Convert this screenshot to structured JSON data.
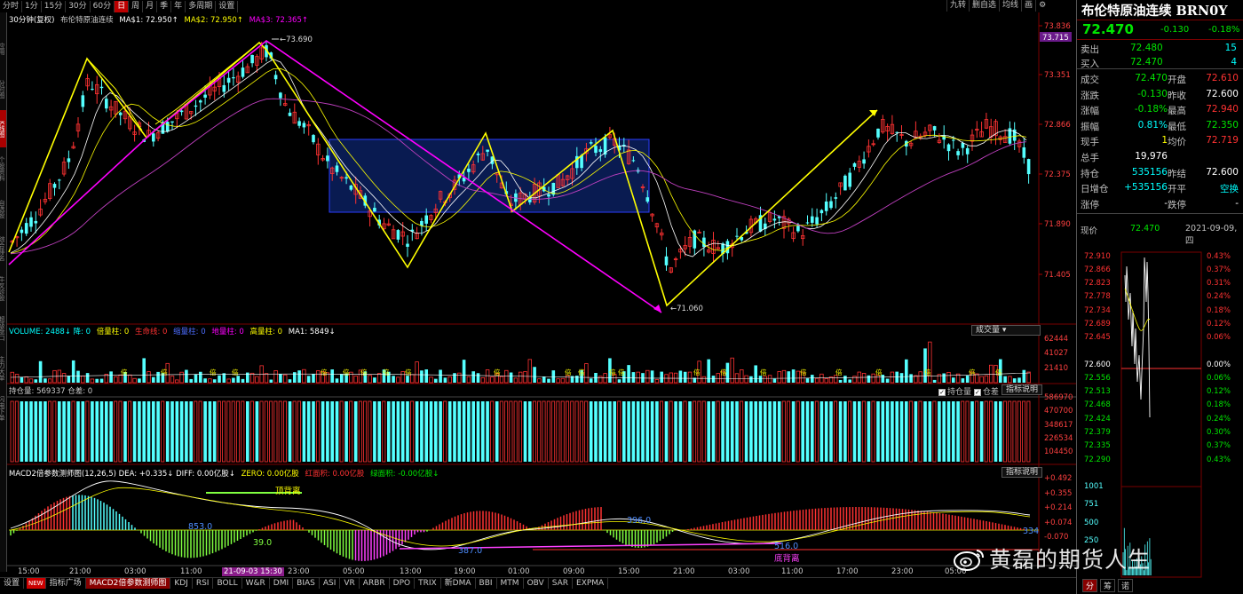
{
  "toolbar": {
    "left": [
      "分时",
      "1分",
      "15分",
      "30分",
      "60分",
      "日",
      "周",
      "月",
      "季",
      "年",
      "多周期",
      "设置"
    ],
    "active": "日",
    "right": [
      "九转",
      "删自选",
      "均线",
      "画",
      "⚙"
    ]
  },
  "left_tabs": [
    "应用",
    "分时图",
    "K线图",
    "个股资料",
    "自选股",
    "综合排名",
    "牛叉诊股",
    "超级盘口",
    "主力大单",
    "闪电下单"
  ],
  "price_title": {
    "period": "30分钟(复权)",
    "name": "布伦特原油连续",
    "ma1": "MA$1: 72.950↑",
    "ma2": "MA$2: 72.950↑",
    "ma3": "MA$3: 72.365↑"
  },
  "price_axis": [
    "73.836",
    "73.351",
    "72.866",
    "72.375",
    "71.890",
    "71.405"
  ],
  "price_axis_hl": "73.715",
  "annotations": {
    "high": "73.690",
    "low": "71.060"
  },
  "volume": {
    "title_parts": [
      {
        "t": "VOLUME: 2488↓ 降: 0 ",
        "c": "c-c"
      },
      {
        "t": "倍量柱: 0 ",
        "c": "c-y"
      },
      {
        "t": "生命线: 0 ",
        "c": "c-r"
      },
      {
        "t": "缩量柱: 0 ",
        "c": "c-b"
      },
      {
        "t": "地量柱: 0 ",
        "c": "c-m"
      },
      {
        "t": "高量柱: 0 ",
        "c": "c-y"
      },
      {
        "t": "MA1: 5849↓",
        "c": "c-w"
      }
    ],
    "selector": "成交量",
    "axis": [
      "62444",
      "41027",
      "21410"
    ],
    "bar_label": "倍"
  },
  "oi": {
    "title": "持仓量: 569337 仓差: 0",
    "chk1": "持仓量",
    "chk2": "仓差",
    "btn": "指标说明",
    "axis": [
      "586970",
      "470700",
      "348617",
      "226534",
      "104450"
    ]
  },
  "macd": {
    "title_parts": [
      {
        "t": "MACD2倍参数测师图(12,26,5) DEA: +0.335↓ DIFF: 0.00亿股↓ ",
        "c": "c-w"
      },
      {
        "t": "ZERO: 0.00亿股 ",
        "c": "c-y"
      },
      {
        "t": "红面积: 0.00亿股 ",
        "c": "c-r"
      },
      {
        "t": "绿面积: -0.00亿股↓",
        "c": "c-g"
      }
    ],
    "btn": "指标说明",
    "axis": [
      "+0.492",
      "+0.355",
      "+0.214",
      "+0.074",
      "-0.070"
    ],
    "labels": {
      "top_div": "顶背离",
      "bottom_div": "底背离",
      "a": "853.0",
      "b": "39.0",
      "c": "387.0",
      "d": "396.0",
      "e": "516.0",
      "f": "334"
    }
  },
  "time_axis": [
    "15:00",
    "21:00",
    "03:00",
    "11:00",
    "21-09-03 15:30",
    "23:00",
    "05:00",
    "13:00",
    "19:00",
    "01:00",
    "09:00",
    "15:00",
    "21:00",
    "03:00",
    "11:00",
    "17:00",
    "23:00",
    "05:00"
  ],
  "bottom_tabs": [
    "设置",
    "NEW",
    "指标广场",
    "MACD2倍参数测师图",
    "KDJ",
    "RSI",
    "BOLL",
    "W&R",
    "DMI",
    "BIAS",
    "ASI",
    "VR",
    "ARBR",
    "DPO",
    "TRIX",
    "新DMA",
    "BBI",
    "MTM",
    "OBV",
    "SAR",
    "EXPMA"
  ],
  "bottom_active": "MACD2倍参数测师图",
  "quote": {
    "title": "布伦特原油连续 BRN0Y",
    "price": "72.470",
    "change": "-0.130",
    "pct": "-0.18%",
    "rows": [
      {
        "l": "卖出",
        "v": "72.480",
        "v_c": "c-g",
        "r": "15",
        "r_c": "c-c"
      },
      {
        "l": "买入",
        "v": "72.470",
        "v_c": "c-g",
        "r": "4",
        "r_c": "c-c"
      }
    ],
    "detail": [
      {
        "l": "成交",
        "v": "72.470",
        "v_c": "c-g",
        "l2": "开盘",
        "v2": "72.610",
        "v2_c": "c-r"
      },
      {
        "l": "涨跌",
        "v": "-0.130",
        "v_c": "c-g",
        "l2": "昨收",
        "v2": "72.600",
        "v2_c": "c-w"
      },
      {
        "l": "涨幅",
        "v": "-0.18%",
        "v_c": "c-g",
        "l2": "最高",
        "v2": "72.940",
        "v2_c": "c-r"
      },
      {
        "l": "振幅",
        "v": "0.81%",
        "v_c": "c-c",
        "l2": "最低",
        "v2": "72.350",
        "v2_c": "c-g"
      },
      {
        "l": "现手",
        "v": "1",
        "v_c": "c-y",
        "l2": "均价",
        "v2": "72.719",
        "v2_c": "c-r"
      },
      {
        "l": "总手",
        "v": "19,976",
        "v_c": "c-w",
        "l2": "",
        "v2": "",
        "v2_c": "c-w"
      },
      {
        "l": "持仓",
        "v": "535156",
        "v_c": "c-c",
        "l2": "昨结",
        "v2": "72.600",
        "v2_c": "c-w"
      },
      {
        "l": "日增仓",
        "v": "+535156",
        "v_c": "c-c",
        "l2": "开平",
        "v2": "空换",
        "v2_c": "c-c"
      },
      {
        "l": "涨停",
        "v": "",
        "v_c": "c-w",
        "l2": "跌停",
        "v2": "",
        "v2_c": "c-w"
      }
    ],
    "limit_up": "-",
    "limit_down": "-",
    "mini_header": {
      "l": "现价",
      "v": "72.470",
      "d": "2021-09-09,四"
    },
    "mini_left": [
      "72.910",
      "72.866",
      "72.823",
      "72.778",
      "72.734",
      "72.689",
      "72.645",
      "72.600",
      "72.556",
      "72.513",
      "72.468",
      "72.424",
      "72.379",
      "72.335",
      "72.290",
      "1001",
      "751",
      "500",
      "250"
    ],
    "mini_right": [
      "0.43%",
      "0.37%",
      "0.31%",
      "0.24%",
      "0.18%",
      "0.12%",
      "0.06%",
      "0.00%",
      "0.06%",
      "0.12%",
      "0.18%",
      "0.24%",
      "0.30%",
      "0.37%",
      "0.43%"
    ],
    "tabs": [
      "分",
      "筹",
      "诺"
    ]
  },
  "watermark": "黄磊的期货人生"
}
